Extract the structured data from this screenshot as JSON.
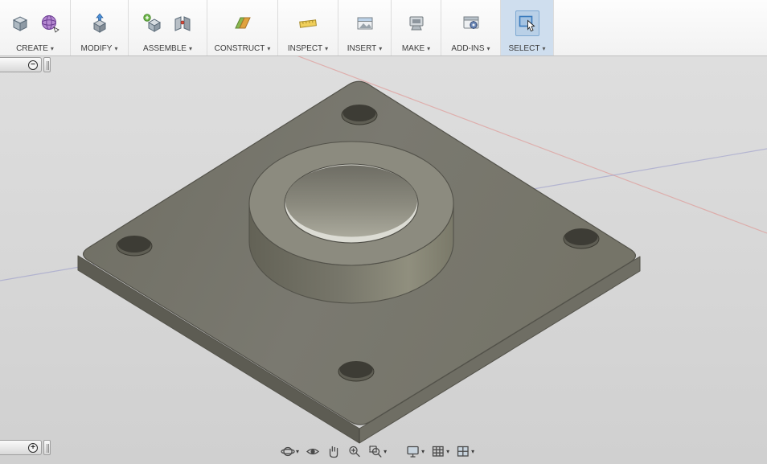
{
  "ui": {
    "caret": "▾"
  },
  "toolbar": {
    "groups": [
      {
        "id": "create",
        "label": "CREATE",
        "icons": [
          "create-solid-icon",
          "create-form-icon"
        ]
      },
      {
        "id": "modify",
        "label": "MODIFY",
        "icons": [
          "press-pull-icon"
        ]
      },
      {
        "id": "assemble",
        "label": "ASSEMBLE",
        "icons": [
          "new-component-icon",
          "joint-icon"
        ]
      },
      {
        "id": "construct",
        "label": "CONSTRUCT",
        "icons": [
          "construct-plane-icon"
        ]
      },
      {
        "id": "inspect",
        "label": "INSPECT",
        "icons": [
          "measure-icon"
        ]
      },
      {
        "id": "insert",
        "label": "INSERT",
        "icons": [
          "insert-image-icon"
        ]
      },
      {
        "id": "make",
        "label": "MAKE",
        "icons": [
          "3d-print-icon"
        ]
      },
      {
        "id": "addins",
        "label": "ADD-INS",
        "icons": [
          "scripts-addins-icon"
        ]
      },
      {
        "id": "select",
        "label": "SELECT",
        "icons": [
          "select-cursor-icon"
        ],
        "highlighted": true
      }
    ]
  },
  "browser_handles": {
    "top_handle_glyph": "−",
    "bottom_handle_glyph": "+"
  },
  "navbar": {
    "view_tools": [
      {
        "name": "orbit",
        "caret": true
      },
      {
        "name": "look-at",
        "caret": false
      },
      {
        "name": "pan",
        "caret": false
      },
      {
        "name": "zoom",
        "caret": false
      },
      {
        "name": "zoom-window",
        "caret": true
      }
    ],
    "display_tools": [
      {
        "name": "display-settings",
        "caret": true
      },
      {
        "name": "grid-and-snaps",
        "caret": true
      },
      {
        "name": "viewports",
        "caret": true
      }
    ]
  },
  "viewport": {
    "background": "#d8d8d8",
    "axes": {
      "x_color": "#e08a86",
      "z_color": "#8e90c8"
    },
    "model": {
      "top_face": "#77766b",
      "left_side": "#5d5c53",
      "right_side": "#6f6e64",
      "boss_ring": "#8c8b7f",
      "hole_bright": "#dcdcd4",
      "corner_hole": "#3d3c35",
      "edge": "#53524a"
    }
  }
}
